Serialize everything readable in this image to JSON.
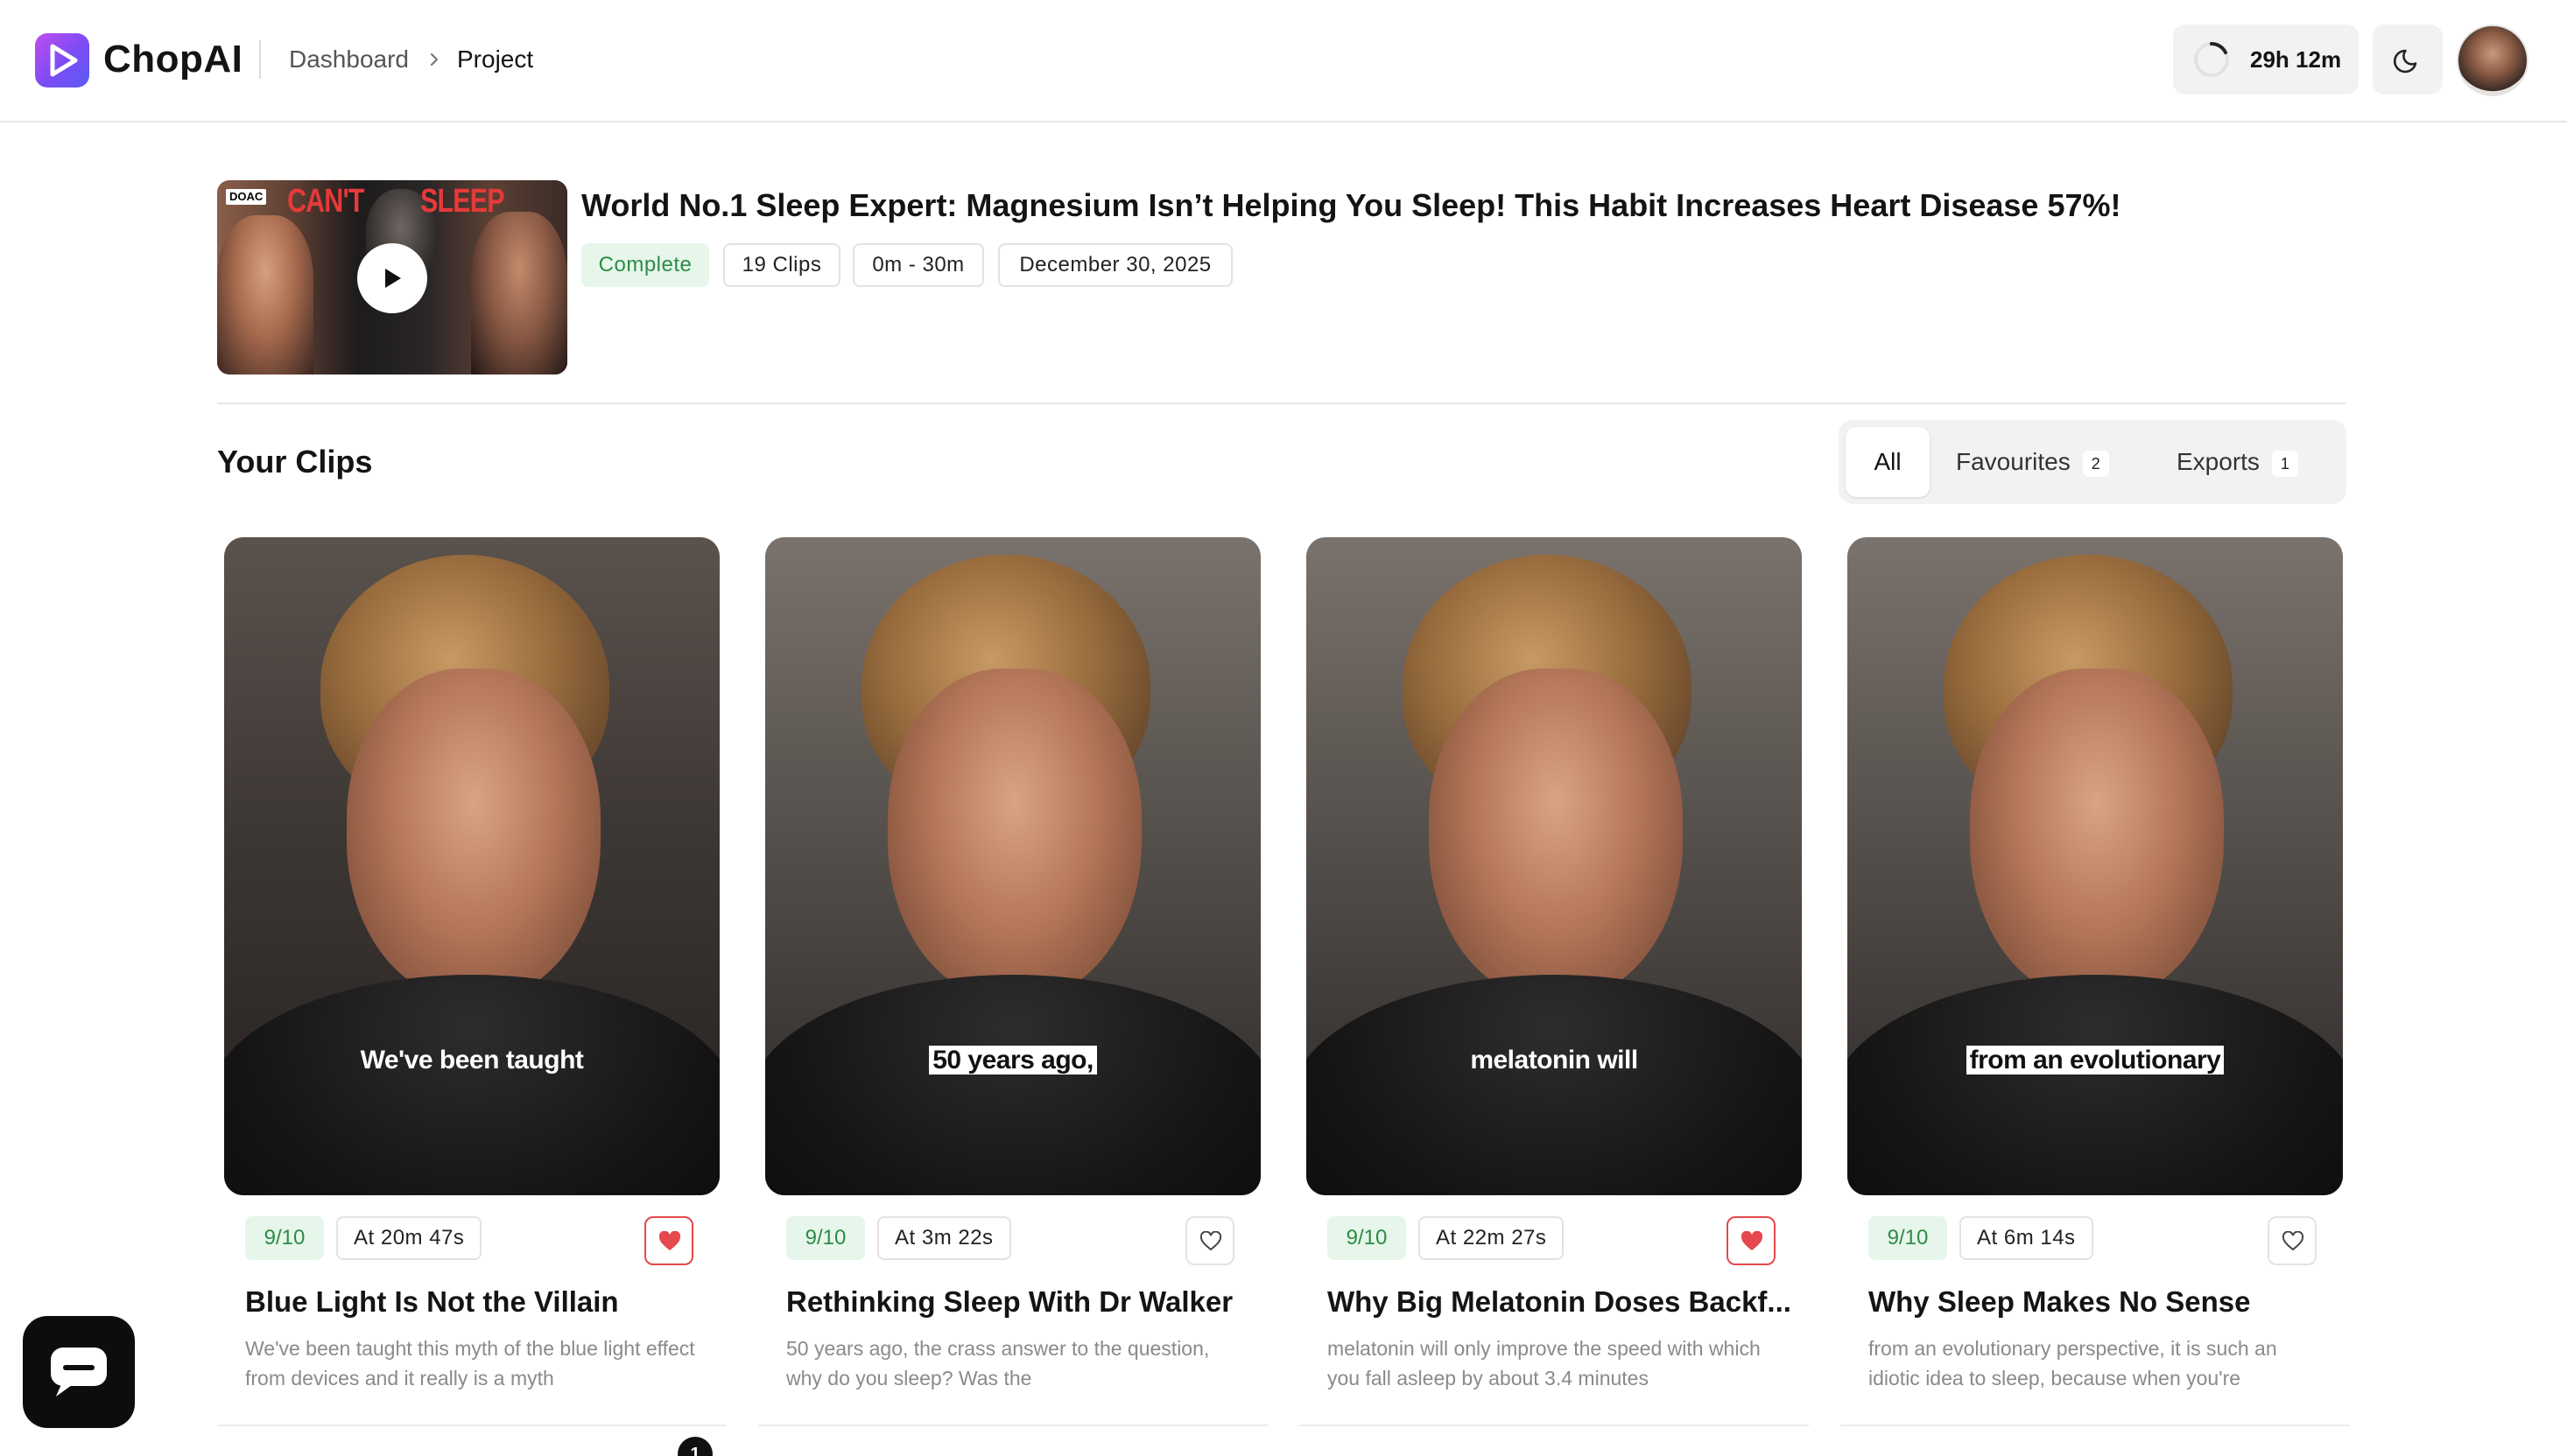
{
  "app": {
    "brand": "ChopAI"
  },
  "breadcrumb": {
    "items": [
      "Dashboard",
      "Project"
    ]
  },
  "header": {
    "credits_time": "29h 12m"
  },
  "project": {
    "thumb_tag": "DOAC",
    "thumb_text_left": "CAN'T",
    "thumb_text_right": "SLEEP",
    "title": "World No.1 Sleep Expert: Magnesium Isn’t Helping You Sleep! This Habit Increases Heart Disease 57%!",
    "status": "Complete",
    "clip_count": "19 Clips",
    "range": "0m - 30m",
    "date": "December 30, 2025"
  },
  "clips_section": {
    "title": "Your Clips",
    "tabs": [
      {
        "label": "All",
        "count": null
      },
      {
        "label": "Favourites",
        "count": "2"
      },
      {
        "label": "Exports",
        "count": "1"
      }
    ]
  },
  "clips": [
    {
      "caption": "We've been taught",
      "caption_boxed": false,
      "score": "9/10",
      "at": "At 20m 47s",
      "favourite": true,
      "title": "Blue Light Is Not the Villain",
      "desc": "We've been taught this myth of the blue light effect from devices and it really is a myth"
    },
    {
      "caption": "50 years ago,",
      "caption_boxed": true,
      "score": "9/10",
      "at": "At 3m 22s",
      "favourite": false,
      "title": "Rethinking Sleep With Dr Walker",
      "desc": "50 years ago, the crass answer to the question, why do you sleep? Was the"
    },
    {
      "caption": "melatonin will",
      "caption_boxed": false,
      "score": "9/10",
      "at": "At 22m 27s",
      "favourite": true,
      "title": "Why Big Melatonin Doses Backf...",
      "desc": "melatonin will only improve the speed with which you fall asleep by about 3.4 minutes"
    },
    {
      "caption": "from an evolutionary",
      "caption_boxed": true,
      "score": "9/10",
      "at": "At 6m 14s",
      "favourite": false,
      "title": "Why Sleep Makes No Sense",
      "desc": "from an evolutionary perspective, it is such an idiotic idea to sleep, because when you're"
    }
  ],
  "notification_count": "1",
  "colors": {
    "accent_green": "#2e8b47",
    "favourite_red": "#e5484d",
    "brand_gradient_start": "#c04cf0",
    "brand_gradient_end": "#5b5cf6"
  }
}
